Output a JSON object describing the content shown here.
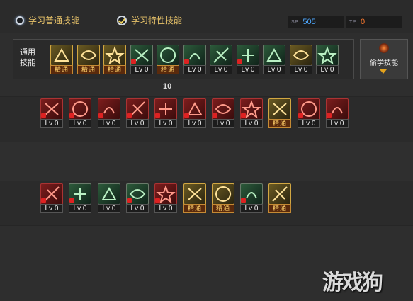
{
  "tabs": {
    "learn_common": "学习普通技能",
    "learn_special": "学习特性技能"
  },
  "counters": {
    "sp_tag": "SP",
    "sp_value": "505",
    "tp_tag": "TP",
    "tp_value": "0"
  },
  "common_skills_label": "通用技能",
  "steal_skill_label": "偷学技能",
  "note_number": "10",
  "mastered_label": "精通",
  "common_skills": [
    {
      "type": "gold",
      "level": "精通",
      "mastered": true
    },
    {
      "type": "gold",
      "level": "精通",
      "mastered": true
    },
    {
      "type": "gold",
      "level": "精通",
      "mastered": true
    },
    {
      "type": "green",
      "level": "Lv 0",
      "mastered": false
    },
    {
      "type": "green",
      "level": "精通",
      "mastered": true
    },
    {
      "type": "green",
      "level": "Lv 0",
      "mastered": false
    },
    {
      "type": "green",
      "level": "Lv 0",
      "mastered": false
    },
    {
      "type": "green",
      "level": "Lv 0",
      "mastered": false
    },
    {
      "type": "green",
      "level": "Lv 0",
      "mastered": false
    },
    {
      "type": "gold",
      "level": "Lv 0",
      "mastered": false
    },
    {
      "type": "green",
      "level": "Lv 0",
      "mastered": false
    }
  ],
  "row2_skills": [
    {
      "type": "red",
      "level": "Lv 0",
      "mastered": false
    },
    {
      "type": "red",
      "level": "Lv 0",
      "mastered": false
    },
    {
      "type": "red",
      "level": "Lv 0",
      "mastered": false
    },
    {
      "type": "red",
      "level": "Lv 0",
      "mastered": false
    },
    {
      "type": "red",
      "level": "Lv 0",
      "mastered": false
    },
    {
      "type": "red",
      "level": "Lv 0",
      "mastered": false
    },
    {
      "type": "red",
      "level": "Lv 0",
      "mastered": false
    },
    {
      "type": "red",
      "level": "Lv 0",
      "mastered": false
    },
    {
      "type": "gold",
      "level": "精通",
      "mastered": true
    },
    {
      "type": "red",
      "level": "Lv 0",
      "mastered": false
    },
    {
      "type": "red",
      "level": "Lv 0",
      "mastered": false
    }
  ],
  "row3_skills": [
    {
      "type": "red",
      "level": "Lv 0",
      "mastered": false
    },
    {
      "type": "green",
      "level": "Lv 0",
      "mastered": false
    },
    {
      "type": "green",
      "level": "Lv 0",
      "mastered": false
    },
    {
      "type": "green",
      "level": "Lv 0",
      "mastered": false
    },
    {
      "type": "red",
      "level": "Lv 0",
      "mastered": false
    },
    {
      "type": "gold",
      "level": "精通",
      "mastered": true
    },
    {
      "type": "gold",
      "level": "精通",
      "mastered": true
    },
    {
      "type": "green",
      "level": "Lv 0",
      "mastered": false
    },
    {
      "type": "gold",
      "level": "精通",
      "mastered": true
    }
  ],
  "watermark": "游戏狗"
}
